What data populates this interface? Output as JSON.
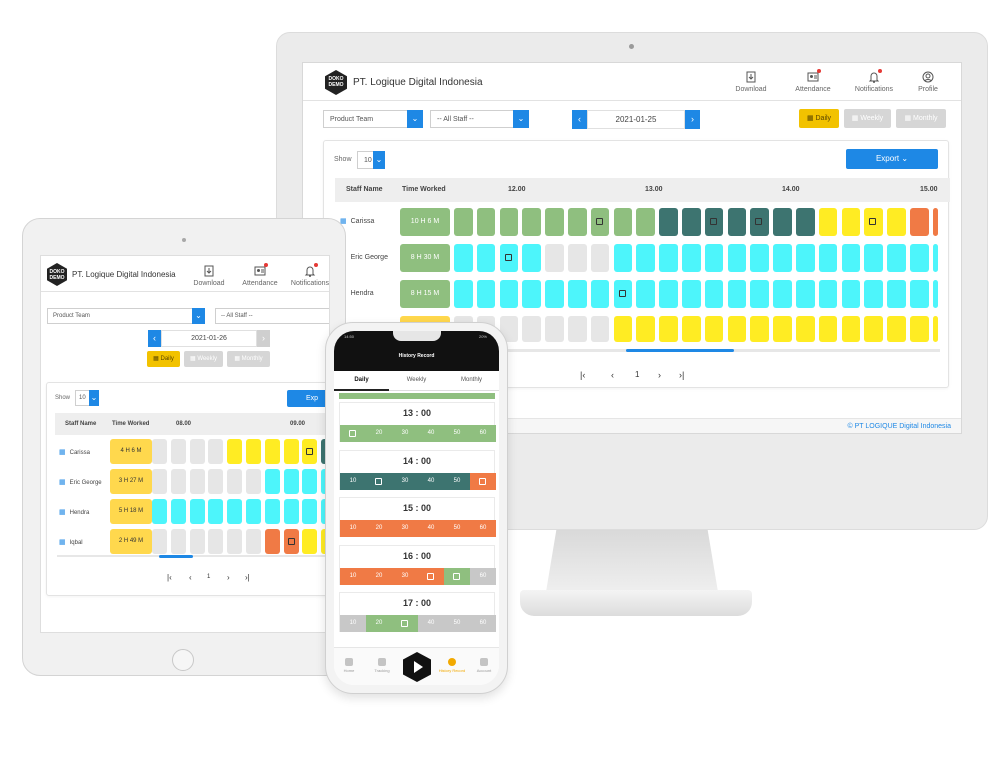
{
  "colors": {
    "accent": "#1e88e5",
    "daily": "#f2c200",
    "green": "#8fbf7f",
    "teal": "#3d7470",
    "cyan": "#4df5fb",
    "yellow": "#ffec23",
    "orange": "#f07a45"
  },
  "desktop": {
    "logo_text": "DOKO DEMO",
    "company": "PT. Logique Digital Indonesia",
    "nav": [
      {
        "label": "Download",
        "icon": "download-icon"
      },
      {
        "label": "Attendance",
        "icon": "attendance-icon"
      },
      {
        "label": "Notifications",
        "icon": "bell-icon"
      },
      {
        "label": "Profile",
        "icon": "user-icon"
      }
    ],
    "team_select": "Product Team",
    "staff_select": "-- All Staff --",
    "date": "2021-01-25",
    "views": [
      "Daily",
      "Weekly",
      "Monthly"
    ],
    "show_label": "Show",
    "show_value": "10",
    "export_label": "Export",
    "col_staff": "Staff Name",
    "col_time": "Time Worked",
    "hours": [
      "12.00",
      "13.00",
      "14.00",
      "15.00"
    ],
    "rows": [
      {
        "name": "Carissa",
        "worked": "10 H 6 M"
      },
      {
        "name": "Eric George",
        "worked": "8 H 30 M"
      },
      {
        "name": "Hendra",
        "worked": "8 H 15 M"
      }
    ],
    "page": "1",
    "footer": "© PT LOGIQUE Digital Indonesia"
  },
  "tablet": {
    "logo_text": "DOKO DEMO",
    "company": "PT. Logique Digital Indonesia",
    "nav": [
      {
        "label": "Download",
        "icon": "download-icon"
      },
      {
        "label": "Attendance",
        "icon": "attendance-icon"
      },
      {
        "label": "Notifications",
        "icon": "bell-icon"
      }
    ],
    "team_select": "Product Team",
    "staff_select": "-- All Staff --",
    "date": "2021-01-26",
    "views": [
      "Daily",
      "Weekly",
      "Monthly"
    ],
    "show_label": "Show",
    "show_value": "10",
    "export_label": "Exp",
    "col_staff": "Staff Name",
    "col_time": "Time Worked",
    "hours": [
      "08.00",
      "09.00"
    ],
    "rows": [
      {
        "name": "Carissa",
        "worked": "4 H 6 M"
      },
      {
        "name": "Eric George",
        "worked": "3 H 27 M"
      },
      {
        "name": "Hendra",
        "worked": "5 H 18 M"
      },
      {
        "name": "Iqbal",
        "worked": "2 H 49 M"
      }
    ],
    "page": "1"
  },
  "phone": {
    "time": "14:50",
    "battery": "20%",
    "title": "History Record",
    "tabs": [
      "Daily",
      "Weekly",
      "Monthly"
    ],
    "hours": [
      "13 : 00",
      "14 : 00",
      "15 : 00",
      "16 : 00",
      "17 : 00"
    ],
    "minutes": [
      "10",
      "20",
      "30",
      "40",
      "50",
      "60"
    ],
    "bottom_nav": [
      "Home",
      "Tracking",
      "History Record",
      "Account"
    ]
  }
}
